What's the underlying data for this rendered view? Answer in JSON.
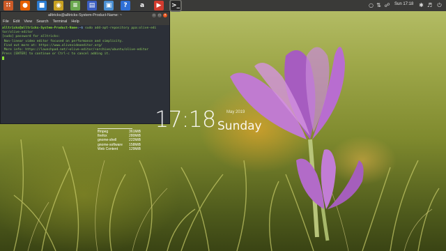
{
  "topbar": {
    "clock": "Sun 17:18",
    "dock_items": [
      {
        "name": "dash-home-icon",
        "glyph": "∷",
        "color": "#cc5a27"
      },
      {
        "name": "firefox-icon",
        "glyph": "●",
        "color": "#e66000"
      },
      {
        "name": "windows-explorer-icon",
        "glyph": "■",
        "color": "#2b7bd0"
      },
      {
        "name": "webcam-icon",
        "glyph": "◉",
        "color": "#c8a020"
      },
      {
        "name": "system-monitor-icon",
        "glyph": "≡",
        "color": "#6aa84f"
      },
      {
        "name": "document-viewer-icon",
        "glyph": "▤",
        "color": "#3b5ec2"
      },
      {
        "name": "files-icon",
        "glyph": "▣",
        "color": "#4a8fd1"
      },
      {
        "name": "help-icon",
        "glyph": "?",
        "color": "#2f6fd6"
      },
      {
        "name": "amazon-icon",
        "glyph": "a",
        "color": "#3a3a3a"
      },
      {
        "name": "screen-recorder-icon",
        "glyph": "▶",
        "color": "#d23b2e"
      },
      {
        "name": "terminal-icon",
        "glyph": ">_",
        "color": "#2a2a2a"
      }
    ]
  },
  "terminal": {
    "title": "alltricks@alltricks-System-Product-Name: ~",
    "menu": [
      "File",
      "Edit",
      "View",
      "Search",
      "Terminal",
      "Help"
    ],
    "prompt_user": "alltricks@alltricks-System-Product-Name",
    "prompt_path": ":~$",
    "command": " sudo add-apt-repository ppa:olive-edi",
    "lines": [
      "tor/olive-editor",
      "[sudo] password for alltricks:",
      " Non-linear video editor focused on performance and simplicity.",
      "",
      " Find out more at: https://www.olivevideoeditor.org/",
      " More info: https://launchpad.net/~olive-editor/+archive/ubuntu/olive-editor",
      "Press [ENTER] to continue or Ctrl-c to cancel adding it."
    ]
  },
  "conky": {
    "time": "17:18",
    "weekday": "Sunday",
    "date": "May 2019",
    "processes": [
      {
        "name": "ffmpeg",
        "mem": "361MiB"
      },
      {
        "name": "firefox",
        "mem": "280MiB"
      },
      {
        "name": "gnome-shell",
        "mem": "222MiB"
      },
      {
        "name": "gnome-software",
        "mem": "158MiB"
      },
      {
        "name": "Web Content",
        "mem": "129MiB"
      }
    ]
  }
}
